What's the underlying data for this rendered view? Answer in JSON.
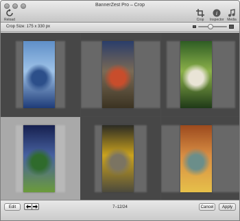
{
  "window": {
    "title": "BannerZest Pro – Crop"
  },
  "toolbar": {
    "reload_label": "Reload",
    "crop_label": "Crop",
    "inspector_label": "Inspector",
    "media_label": "Media"
  },
  "infobar": {
    "crop_size": "Crop Size: 175 x 330 px",
    "zoom_level": 0.4
  },
  "photos": [
    {
      "name": "kayaker-lake",
      "colors": [
        "#5f8fc8",
        "#9fc3e8",
        "#2c4f8a",
        "#1e3b78"
      ]
    },
    {
      "name": "two-cyclists-sunset",
      "colors": [
        "#2a3d6b",
        "#7a6a55",
        "#c84d2c",
        "#3b3322"
      ]
    },
    {
      "name": "cyclists-green-blur",
      "colors": [
        "#2e5d24",
        "#8cb14a",
        "#e9e4d6",
        "#1f3a18"
      ]
    },
    {
      "name": "mountain-biker-air",
      "colors": [
        "#16204f",
        "#4761a0",
        "#2f6b2c",
        "#6b9b3a"
      ]
    },
    {
      "name": "mountain-biker-rocks",
      "colors": [
        "#2c2c24",
        "#caa21e",
        "#7b7462",
        "#4c4a3c"
      ]
    },
    {
      "name": "raft-canyon",
      "colors": [
        "#9c4a1e",
        "#d88d43",
        "#6b8e8a",
        "#e6c04a"
      ]
    }
  ],
  "bottom": {
    "edit_label": "Edit",
    "pager": "7–12/24",
    "cancel_label": "Cancel",
    "apply_label": "Apply"
  }
}
